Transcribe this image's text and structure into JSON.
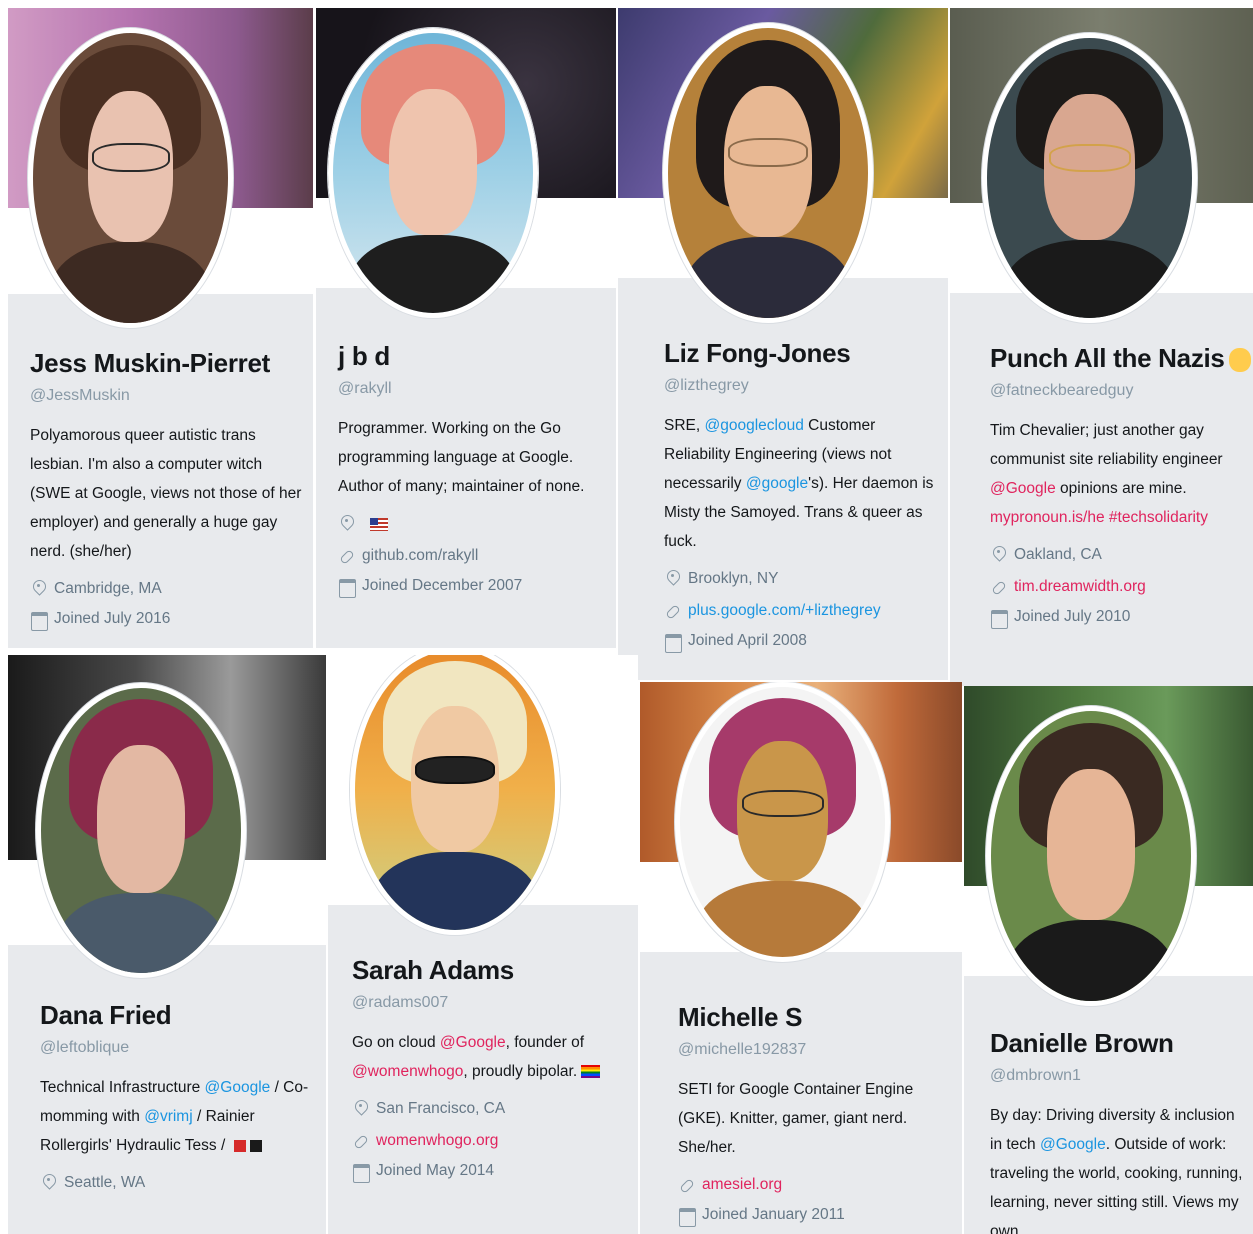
{
  "colors": {
    "card_bg": "#e8eaed",
    "name": "#14171a",
    "muted": "#8899a6",
    "link_blue": "#1b95e0",
    "link_pink": "#e0245e"
  },
  "profiles": [
    {
      "name": "Jess Muskin-Pierret",
      "handle": "@JessMuskin",
      "bio": "Polyamorous queer autistic trans lesbian. I'm also a computer witch (SWE at Google, views not those of her employer) and generally a huge gay nerd. (she/her)",
      "location": "Cambridge, MA",
      "joined": "Joined July 2016"
    },
    {
      "name": "j b d",
      "handle": "@rakyll",
      "bio": "Programmer. Working on the Go programming language at Google. Author of many; maintainer of none.",
      "website": "github.com/rakyll",
      "joined": "Joined December 2007"
    },
    {
      "name": "Liz Fong-Jones",
      "handle": "@lizthegrey",
      "bio_1": "SRE, ",
      "bio_mention_1": "@googlecloud",
      "bio_2": " Customer Reliability Engineering (views not necessarily ",
      "bio_mention_2": "@google",
      "bio_3": "'s). Her daemon is Misty the Samoyed. Trans & queer as fuck.",
      "location": "Brooklyn, NY",
      "website": "plus.google.com/+lizthegrey",
      "joined": "Joined April 2008"
    },
    {
      "name": "Punch All the Nazis",
      "handle": "@fatneckbearedguy",
      "bio_1": "Tim Chevalier; just another gay communist site reliability engineer ",
      "bio_mention_1": "@Google",
      "bio_2": " opinions are mine. ",
      "bio_link": "mypronoun.is/he #techsolidarity",
      "location": "Oakland, CA",
      "website": "tim.dreamwidth.org",
      "joined": "Joined July 2010"
    },
    {
      "name": "Dana Fried",
      "handle": "@leftoblique",
      "bio_1": "Technical Infrastructure ",
      "bio_mention_1": "@Google",
      "bio_2": " / Co-momming with ",
      "bio_mention_2": "@vrimj",
      "bio_3": " / Rainier Rollergirls' Hydraulic Tess / ",
      "location": "Seattle, WA"
    },
    {
      "name": "Sarah Adams",
      "handle": "@radams007",
      "bio_1": "Go on cloud ",
      "bio_mention_1": "@Google",
      "bio_2": ", founder of ",
      "bio_mention_2": "@womenwhogo",
      "bio_3": ", proudly bipolar. ",
      "location": "San Francisco, CA",
      "website": "womenwhogo.org",
      "joined": "Joined May 2014"
    },
    {
      "name": "Michelle S",
      "handle": "@michelle192837",
      "bio": "SETI for Google Container Engine (GKE). Knitter, gamer, giant nerd. She/her.",
      "website": "amesiel.org",
      "joined": "Joined January 2011"
    },
    {
      "name": "Danielle Brown",
      "handle": "@dmbrown1",
      "bio_1": "By day: Driving diversity & inclusion in tech ",
      "bio_mention_1": "@Google",
      "bio_2": ". Outside of work: traveling the world, cooking, running, learning, never sitting still. Views my own."
    }
  ]
}
